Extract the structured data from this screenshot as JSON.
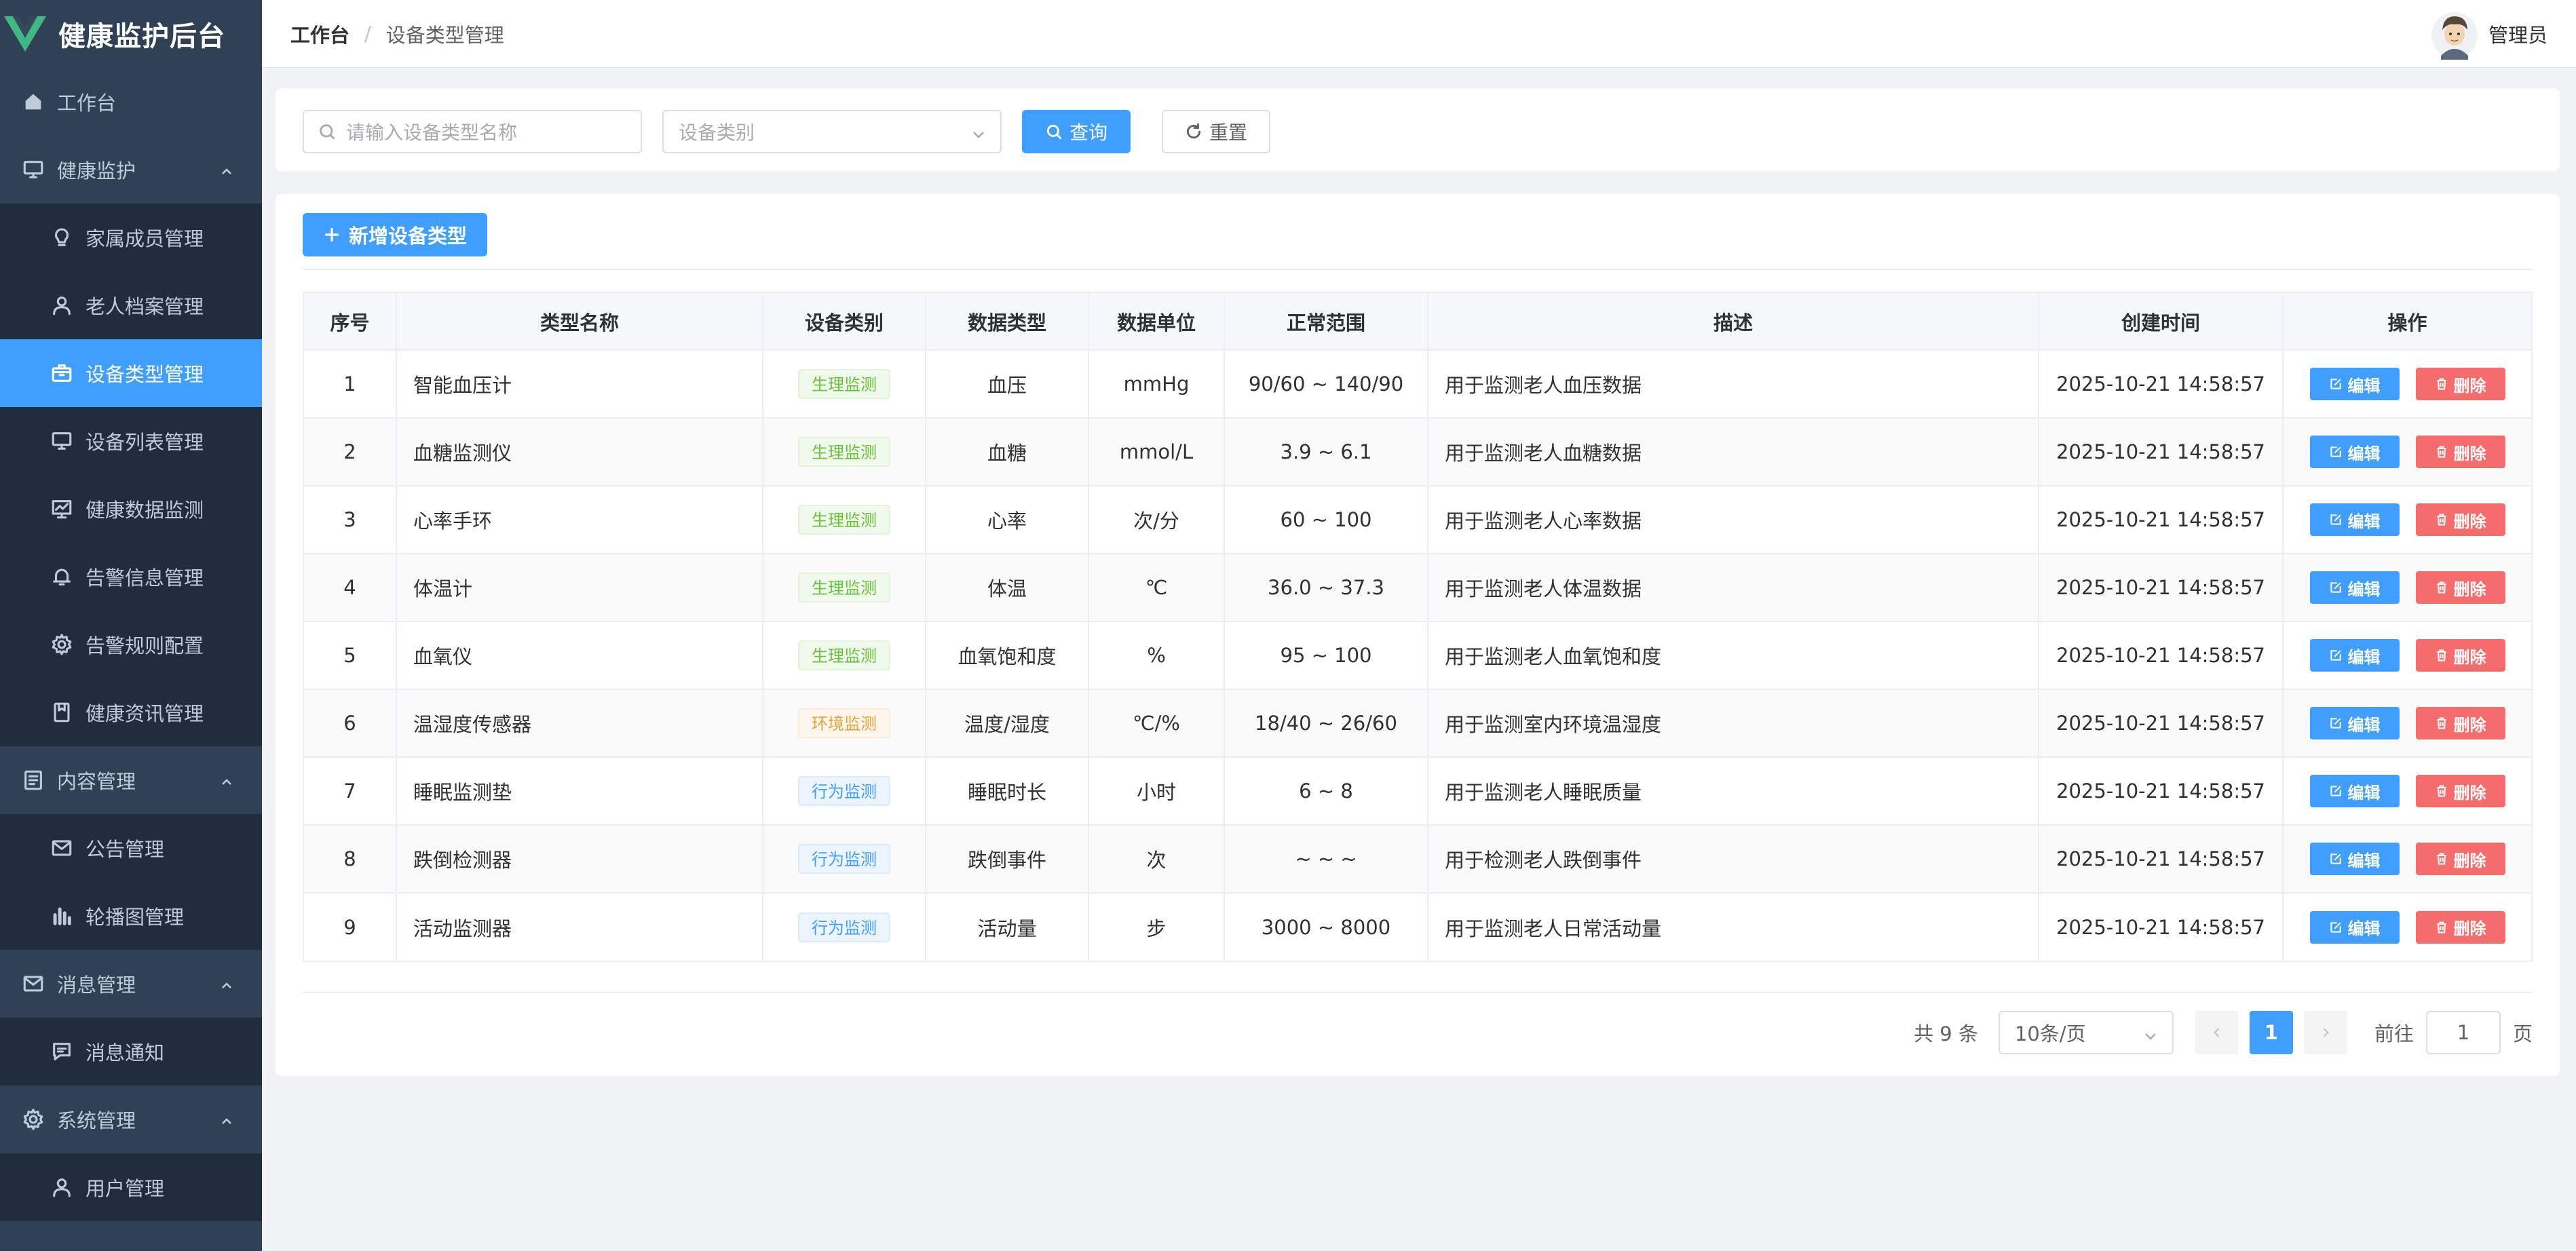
{
  "app": {
    "title": "健康监护后台"
  },
  "sidebar": {
    "items": [
      {
        "label": "工作台",
        "icon": "home-icon",
        "level": "top"
      },
      {
        "label": "健康监护",
        "icon": "monitor-icon",
        "level": "top",
        "expanded": true
      },
      {
        "label": "家属成员管理",
        "icon": "lightbulb-icon",
        "level": "sub"
      },
      {
        "label": "老人档案管理",
        "icon": "user-icon",
        "level": "sub"
      },
      {
        "label": "设备类型管理",
        "icon": "box-icon",
        "level": "sub",
        "active": true
      },
      {
        "label": "设备列表管理",
        "icon": "monitor-icon",
        "level": "sub"
      },
      {
        "label": "健康数据监测",
        "icon": "data-board-icon",
        "level": "sub"
      },
      {
        "label": "告警信息管理",
        "icon": "bell-icon",
        "level": "sub"
      },
      {
        "label": "告警规则配置",
        "icon": "gear-icon",
        "level": "sub"
      },
      {
        "label": "健康资讯管理",
        "icon": "document-icon",
        "level": "sub"
      },
      {
        "label": "内容管理",
        "icon": "list-icon",
        "level": "top",
        "expanded": true
      },
      {
        "label": "公告管理",
        "icon": "message-icon",
        "level": "sub"
      },
      {
        "label": "轮播图管理",
        "icon": "histogram-icon",
        "level": "sub"
      },
      {
        "label": "消息管理",
        "icon": "message-icon",
        "level": "top",
        "expanded": true
      },
      {
        "label": "消息通知",
        "icon": "chat-icon",
        "level": "sub"
      },
      {
        "label": "系统管理",
        "icon": "gear-icon",
        "level": "top",
        "expanded": true
      },
      {
        "label": "用户管理",
        "icon": "user-icon",
        "level": "sub"
      }
    ]
  },
  "header": {
    "breadcrumb": [
      "工作台",
      "设备类型管理"
    ],
    "separator": "/",
    "user_name": "管理员"
  },
  "search": {
    "name_placeholder": "请输入设备类型名称",
    "category_placeholder": "设备类别",
    "query_label": "查询",
    "reset_label": "重置"
  },
  "toolbar": {
    "add_label": "新增设备类型"
  },
  "table": {
    "columns": [
      "序号",
      "类型名称",
      "设备类别",
      "数据类型",
      "数据单位",
      "正常范围",
      "描述",
      "创建时间",
      "操作"
    ],
    "edit_label": "编辑",
    "delete_label": "删除",
    "rows": [
      {
        "no": "1",
        "name": "智能血压计",
        "category": "生理监测",
        "data_type": "血压",
        "unit": "mmHg",
        "range": "90/60 ~ 140/90",
        "desc": "用于监测老人血压数据",
        "created": "2025-10-21 14:58:57"
      },
      {
        "no": "2",
        "name": "血糖监测仪",
        "category": "生理监测",
        "data_type": "血糖",
        "unit": "mmol/L",
        "range": "3.9 ~ 6.1",
        "desc": "用于监测老人血糖数据",
        "created": "2025-10-21 14:58:57"
      },
      {
        "no": "3",
        "name": "心率手环",
        "category": "生理监测",
        "data_type": "心率",
        "unit": "次/分",
        "range": "60 ~ 100",
        "desc": "用于监测老人心率数据",
        "created": "2025-10-21 14:58:57"
      },
      {
        "no": "4",
        "name": "体温计",
        "category": "生理监测",
        "data_type": "体温",
        "unit": "℃",
        "range": "36.0 ~ 37.3",
        "desc": "用于监测老人体温数据",
        "created": "2025-10-21 14:58:57"
      },
      {
        "no": "5",
        "name": "血氧仪",
        "category": "生理监测",
        "data_type": "血氧饱和度",
        "unit": "%",
        "range": "95 ~ 100",
        "desc": "用于监测老人血氧饱和度",
        "created": "2025-10-21 14:58:57"
      },
      {
        "no": "6",
        "name": "温湿度传感器",
        "category": "环境监测",
        "data_type": "温度/湿度",
        "unit": "℃/%",
        "range": "18/40 ~ 26/60",
        "desc": "用于监测室内环境温湿度",
        "created": "2025-10-21 14:58:57"
      },
      {
        "no": "7",
        "name": "睡眠监测垫",
        "category": "行为监测",
        "data_type": "睡眠时长",
        "unit": "小时",
        "range": "6 ~ 8",
        "desc": "用于监测老人睡眠质量",
        "created": "2025-10-21 14:58:57"
      },
      {
        "no": "8",
        "name": "跌倒检测器",
        "category": "行为监测",
        "data_type": "跌倒事件",
        "unit": "次",
        "range": "~ ~ ~",
        "desc": "用于检测老人跌倒事件",
        "created": "2025-10-21 14:58:57"
      },
      {
        "no": "9",
        "name": "活动监测器",
        "category": "行为监测",
        "data_type": "活动量",
        "unit": "步",
        "range": "3000 ~ 8000",
        "desc": "用于监测老人日常活动量",
        "created": "2025-10-21 14:58:57"
      }
    ]
  },
  "tag_colors": {
    "生理监测": {
      "text": "#67c23a",
      "bg": "#f0f9eb",
      "border": "#e1f3d8"
    },
    "环境监测": {
      "text": "#e6a23c",
      "bg": "#fdf6ec",
      "border": "#faecd8"
    },
    "行为监测": {
      "text": "#409eff",
      "bg": "#ecf5ff",
      "border": "#d9ecff"
    }
  },
  "pagination": {
    "total_text": "共 9 条",
    "page_size": "10条/页",
    "current_page": "1",
    "goto_label": "前往",
    "goto_value": "1",
    "page_suffix": "页"
  },
  "colors": {
    "sidebar_bg": "#304156",
    "sub_bg": "#1f2d3d",
    "accent": "#409eff",
    "danger": "#f56c6c"
  }
}
